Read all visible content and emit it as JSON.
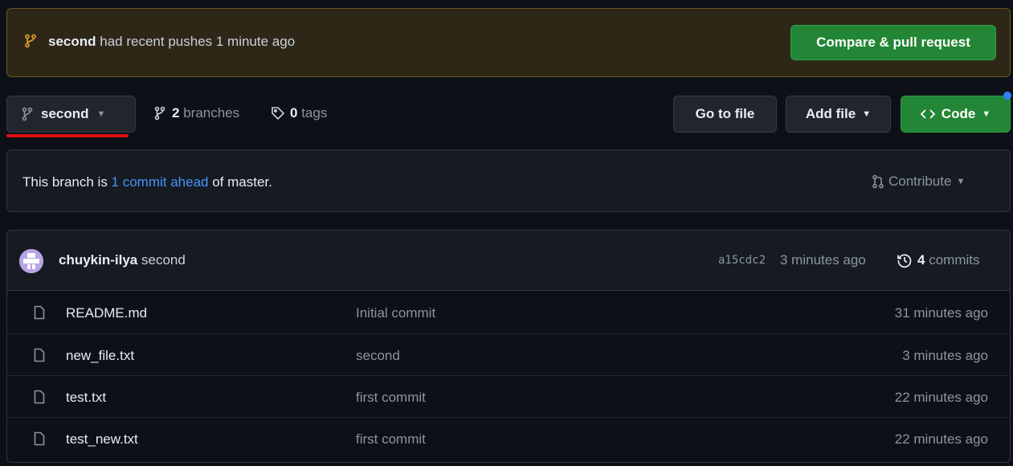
{
  "banner": {
    "branch": "second",
    "text": "had recent pushes 1 minute ago",
    "compare_button": "Compare & pull request"
  },
  "toolbar": {
    "branch_name": "second",
    "branch_count": "2",
    "branches_label": "branches",
    "tag_count": "0",
    "tags_label": "tags",
    "go_to_file": "Go to file",
    "add_file": "Add file",
    "code": "Code"
  },
  "ahead": {
    "prefix": "This branch is ",
    "link": "1 commit ahead",
    "suffix": " of master.",
    "contribute": "Contribute"
  },
  "commit": {
    "author": "chuykin-ilya",
    "message": "second",
    "sha": "a15cdc2",
    "time": "3 minutes ago",
    "count": "4",
    "count_label": "commits"
  },
  "files": [
    {
      "name": "README.md",
      "message": "Initial commit",
      "time": "31 minutes ago"
    },
    {
      "name": "new_file.txt",
      "message": "second",
      "time": "3 minutes ago"
    },
    {
      "name": "test.txt",
      "message": "first commit",
      "time": "22 minutes ago"
    },
    {
      "name": "test_new.txt",
      "message": "first commit",
      "time": "22 minutes ago"
    }
  ],
  "colors": {
    "background": "#0d1117",
    "banner_bg": "#2e2718",
    "green_button": "#238636",
    "link_blue": "#4493f8",
    "annotation_red": "#e01010"
  }
}
